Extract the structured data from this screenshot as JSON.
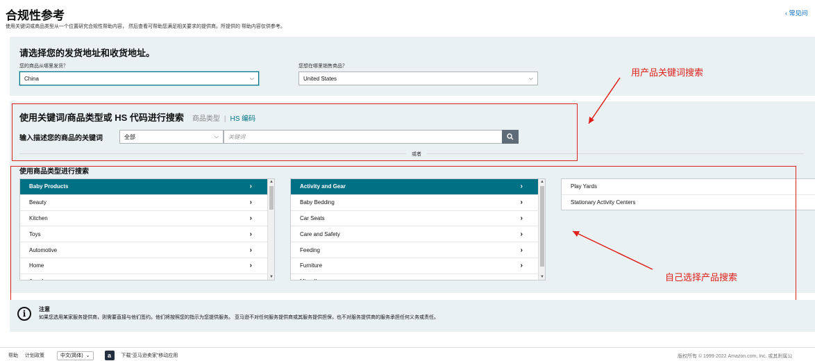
{
  "header": {
    "title": "合规性参考",
    "description": "使用关键词或商品类型从一个位置研究合规性帮助内容， 然后查看可帮助您满足相关要求的提供商。所提供的 帮助内容仅供参考。",
    "faq_link": "‹ 常见问"
  },
  "location": {
    "title": "请选择您的发货地址和收货地址。",
    "ship_from_label": "您的商品从哪里发货？",
    "ship_from_value": "China",
    "sell_to_label": "您想在哪里销售商品？",
    "sell_to_value": "United States"
  },
  "search": {
    "title": "使用关键词/商品类型或 HS 代码进行搜索",
    "tab_product_type": "商品类型",
    "tab_separator": "|",
    "tab_hs_code": "HS 编码",
    "keyword_label": "输入描述您的商品的关键词",
    "category_value": "全部",
    "keyword_placeholder": "关键词",
    "or_text": "或者"
  },
  "browse": {
    "title": "使用商品类型进行搜索",
    "column1": [
      {
        "label": "Baby Products",
        "selected": true
      },
      {
        "label": "Beauty",
        "selected": false
      },
      {
        "label": "Kitchen",
        "selected": false
      },
      {
        "label": "Toys",
        "selected": false
      },
      {
        "label": "Automotive",
        "selected": false
      },
      {
        "label": "Home",
        "selected": false
      },
      {
        "label": "Jewelry",
        "selected": false
      }
    ],
    "column2": [
      {
        "label": "Activity and Gear",
        "selected": true
      },
      {
        "label": "Baby Bedding",
        "selected": false
      },
      {
        "label": "Car Seats",
        "selected": false
      },
      {
        "label": "Care and Safety",
        "selected": false
      },
      {
        "label": "Feeding",
        "selected": false
      },
      {
        "label": "Furniture",
        "selected": false
      },
      {
        "label": "Miscellaneous",
        "selected": false
      }
    ],
    "column3": [
      {
        "label": "Play Yards"
      },
      {
        "label": "Stationary Activity Centers"
      }
    ],
    "arrow_glyph": "›"
  },
  "annotations": {
    "keyword_search": "用产品关键词搜索",
    "self_select": "自己选择产品搜索"
  },
  "notice": {
    "icon": "info-icon",
    "title": "注意",
    "text": "如果您选用某家服务提供商，则需要直接与他们签约。他们将按照您的指示为您提供服务。 亚马逊不对任何服务提供商或其服务提供担保，也不对服务提供商的服务承担任何义务或责任。"
  },
  "footer": {
    "help": "帮助",
    "policies": "计划政策",
    "language": "中文(简体)",
    "app_icon_letter": "a",
    "app_download": "下载“亚马逊卖家”移动应用",
    "copyright": "版权所有 © 1999-2022 Amazon.com, Inc. 或其附属公"
  },
  "colors": {
    "accent": "#007185",
    "panel_bg": "#e9f1f2",
    "annotation_red": "#e0201b"
  }
}
